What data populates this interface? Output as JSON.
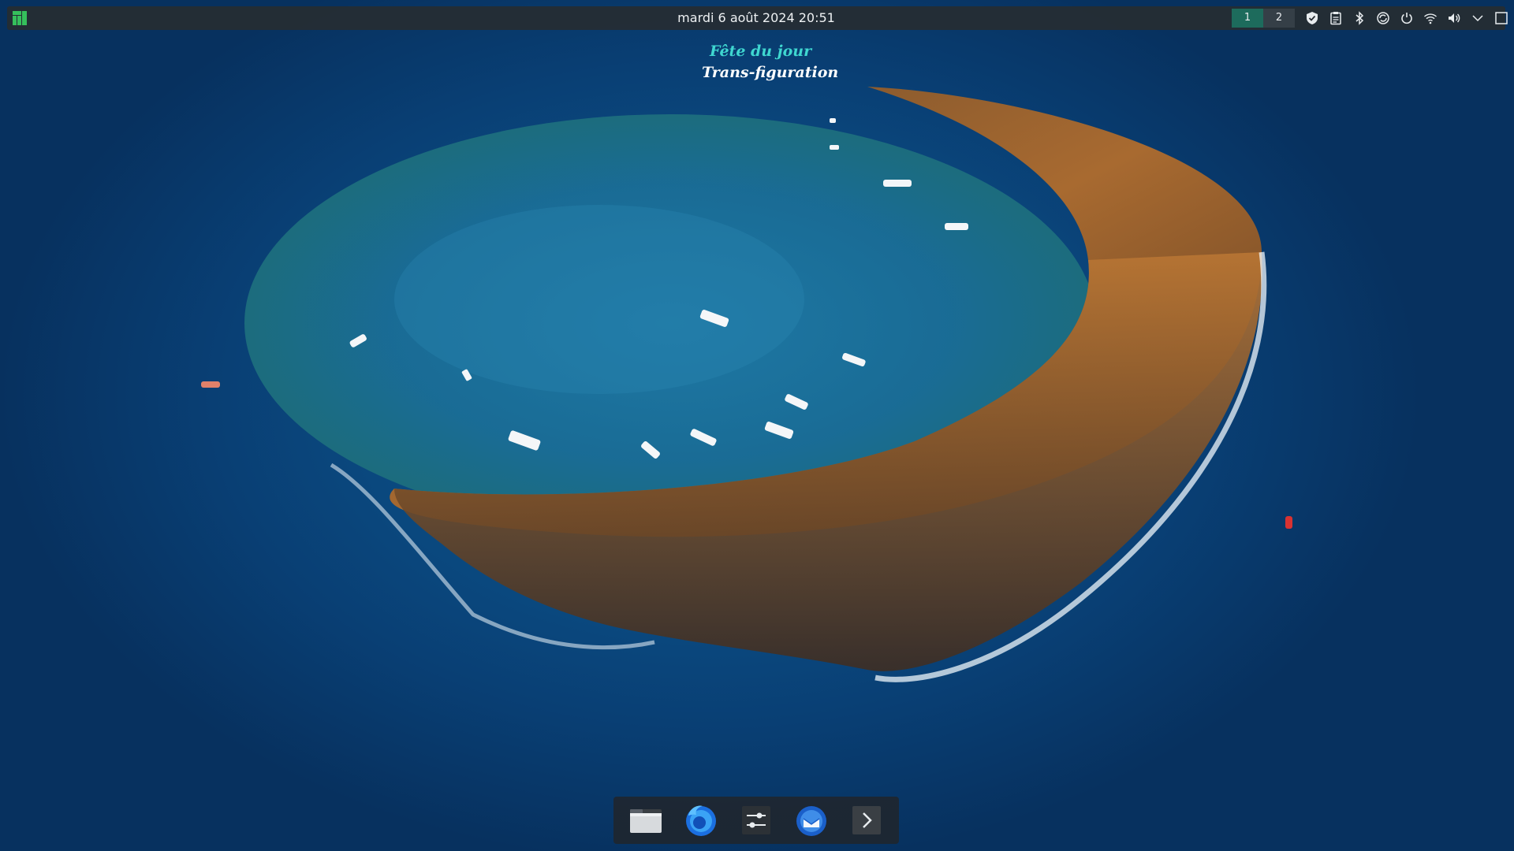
{
  "panel": {
    "clock": "mardi 6 août 2024 20:51",
    "pager": [
      {
        "label": "1",
        "active": true
      },
      {
        "label": "2",
        "active": false
      }
    ],
    "tray_icons": [
      "shield-icon",
      "clipboard-icon",
      "bluetooth-icon",
      "update-icon",
      "power-icon",
      "wifi-icon",
      "volume-icon",
      "expand-arrow-icon",
      "show-desktop-icon"
    ],
    "accent_color": "#1d6b5c",
    "launcher_color": "#35bf5c"
  },
  "widget": {
    "title": "Fête du jour",
    "name": "Trans-figuration",
    "title_color": "#3fd7d0"
  },
  "dock": {
    "items": [
      "file-manager-icon",
      "firefox-icon",
      "system-settings-icon",
      "thunderbird-icon",
      "chevron-right-icon"
    ]
  }
}
